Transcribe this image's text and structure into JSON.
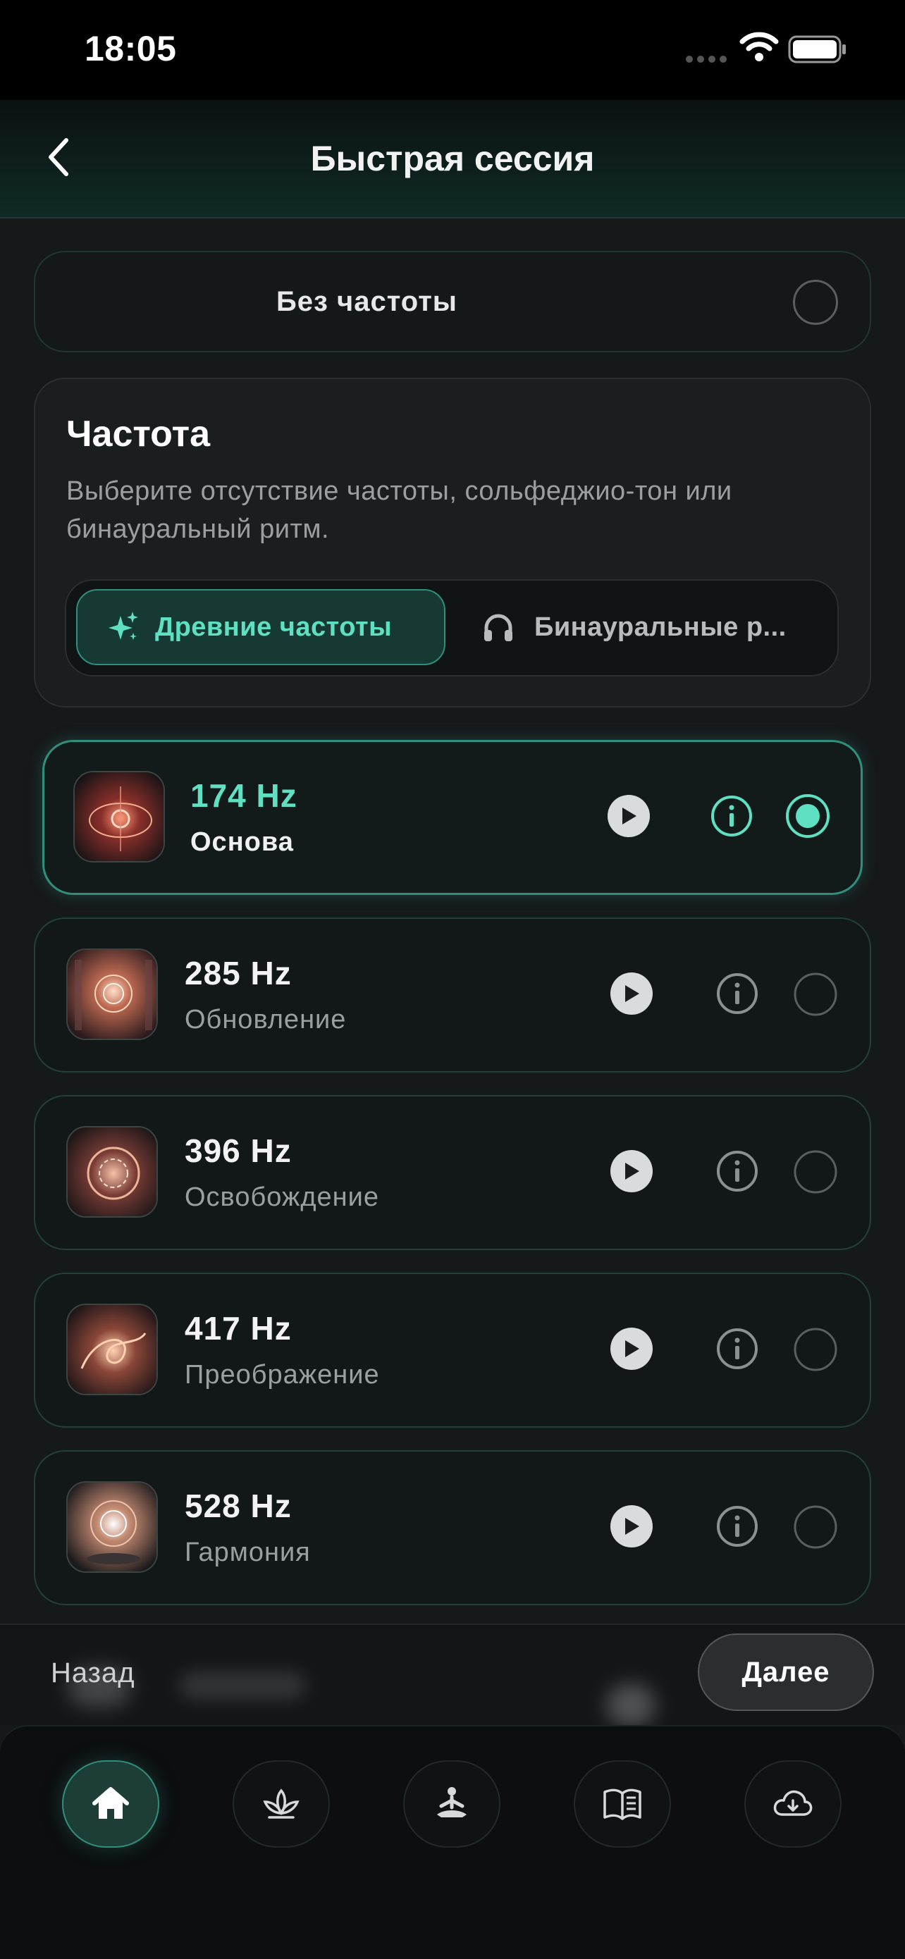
{
  "status_bar": {
    "time": "18:05"
  },
  "header": {
    "title": "Быстрая сессия"
  },
  "no_frequency": {
    "label": "Без частоты",
    "selected": false
  },
  "frequency_section": {
    "title": "Частота",
    "description": "Выберите отсутствие частоты, сольфеджио-тон или бинауральный ритм.",
    "tabs": [
      {
        "label": "Древние частоты",
        "icon": "sparkles-icon",
        "active": true
      },
      {
        "label": "Бинауральные р...",
        "icon": "headphones-icon",
        "active": false
      }
    ]
  },
  "frequencies": [
    {
      "hz": "174 Hz",
      "name": "Основа",
      "selected": true
    },
    {
      "hz": "285 Hz",
      "name": "Обновление",
      "selected": false
    },
    {
      "hz": "396 Hz",
      "name": "Освобождение",
      "selected": false
    },
    {
      "hz": "417 Hz",
      "name": "Преображение",
      "selected": false
    },
    {
      "hz": "528 Hz",
      "name": "Гармония",
      "selected": false
    }
  ],
  "actions": {
    "back_label": "Назад",
    "next_label": "Далее"
  },
  "tab_bar": [
    {
      "icon": "home-icon",
      "active": true
    },
    {
      "icon": "lotus-icon",
      "active": false
    },
    {
      "icon": "meditation-icon",
      "active": false
    },
    {
      "icon": "book-icon",
      "active": false
    },
    {
      "icon": "cloud-download-icon",
      "active": false
    }
  ],
  "colors": {
    "accent": "#5fe0c3",
    "accent_border": "#2f8e7c",
    "background": "#16191a"
  }
}
